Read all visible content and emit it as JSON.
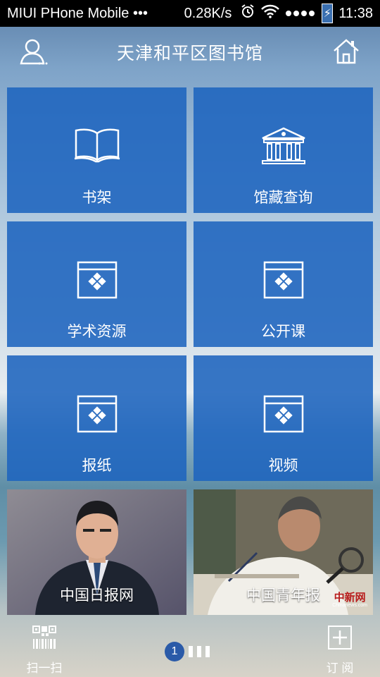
{
  "status_bar": {
    "carrier": "MIUI PHone Mobile •••",
    "speed": "0.28K/s",
    "time": "11:38",
    "alarm_icon": "alarm-icon",
    "wifi_icon": "wifi-icon",
    "signal_icon": "signal-dots-icon",
    "battery_icon": "battery-charging-icon",
    "battery_glyph": "⚡"
  },
  "header": {
    "title": "天津和平区图书馆",
    "user_icon": "user-icon",
    "home_icon": "home-icon"
  },
  "tiles": [
    {
      "label": "书架",
      "icon": "book-icon"
    },
    {
      "label": "馆藏查询",
      "icon": "library-building-icon"
    },
    {
      "label": "学术资源",
      "icon": "resource-window-icon"
    },
    {
      "label": "公开课",
      "icon": "resource-window-icon"
    },
    {
      "label": "报纸",
      "icon": "resource-window-icon"
    },
    {
      "label": "视频",
      "icon": "resource-window-icon"
    }
  ],
  "news": [
    {
      "label": "中国日报网"
    },
    {
      "label": "中国青年报",
      "watermark": "中新网",
      "watermark_url": "Chinanews.com"
    }
  ],
  "bottom_bar": {
    "scan_label": "扫一扫",
    "scan_icon": "qr-barcode-icon",
    "subscribe_label": "订 阅",
    "subscribe_icon": "plus-box-icon",
    "page_current": "1"
  },
  "colors": {
    "tile": "#1e64be",
    "status_bar": "#000000",
    "pager_active": "#2a5aa8"
  }
}
